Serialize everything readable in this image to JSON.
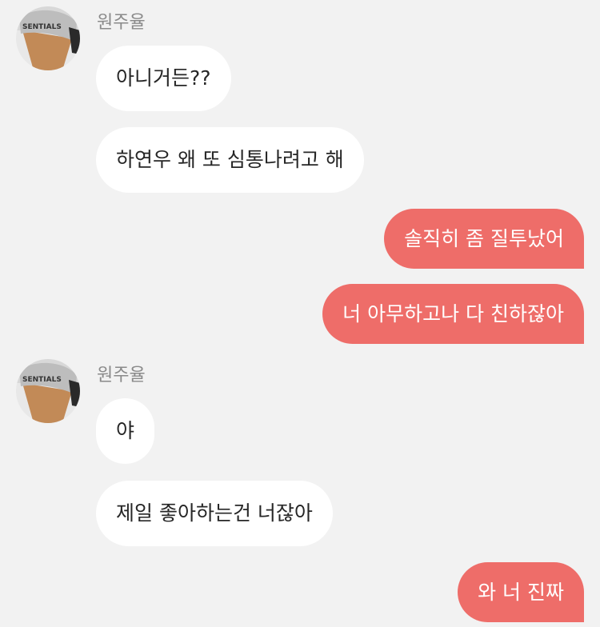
{
  "chat": {
    "sender_name": "원주율",
    "avatar_shirt_text": "SENTIALS",
    "group1": {
      "messages": [
        "아니거든??",
        "하연우 왜 또 심통나려고 해"
      ]
    },
    "outgoing1": {
      "messages": [
        "솔직히 좀 질투났어",
        "너 아무하고나 다 친하잖아"
      ]
    },
    "group2": {
      "messages": [
        "야",
        "제일 좋아하는건 너잖아"
      ]
    },
    "outgoing2": {
      "messages": [
        "와 너 진짜"
      ]
    }
  }
}
